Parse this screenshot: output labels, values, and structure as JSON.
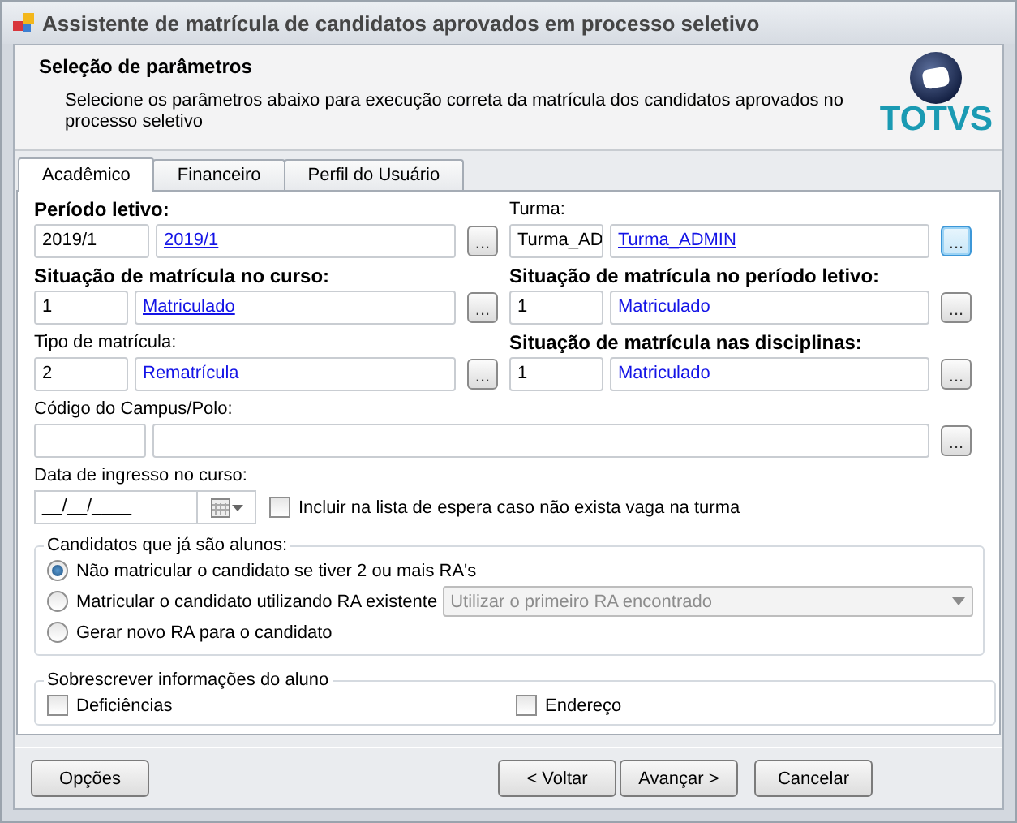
{
  "window": {
    "title": "Assistente de matrícula de candidatos aprovados em processo seletivo"
  },
  "header": {
    "title": "Seleção de parâmetros",
    "description": "Selecione os parâmetros abaixo para execução correta da matrícula dos candidatos aprovados no processo seletivo",
    "logo": "TOTVS"
  },
  "tabs": [
    {
      "label": "Acadêmico",
      "selected": true
    },
    {
      "label": "Financeiro",
      "selected": false
    },
    {
      "label": "Perfil do Usuário",
      "selected": false
    }
  ],
  "fields": [
    {
      "label": "Período letivo:",
      "required": true,
      "code": "2019/1",
      "description": "2019/1",
      "underlined": true,
      "button": "...",
      "focused": false
    },
    {
      "label": "Turma:",
      "required": false,
      "code": "Turma_AD",
      "description": "Turma_ADMIN",
      "underlined": true,
      "button": "...",
      "focused": true
    },
    {
      "label": "Situação de matrícula no curso:",
      "required": true,
      "code": "1",
      "description": "Matriculado",
      "underlined": true,
      "button": "...",
      "focused": false
    },
    {
      "label": "Situação de matrícula no período letivo:",
      "required": true,
      "code": "1",
      "description": "Matriculado",
      "underlined": false,
      "button": "...",
      "focused": false
    },
    {
      "label": "Tipo de matrícula:",
      "required": false,
      "code": "2",
      "description": "Rematrícula",
      "underlined": false,
      "button": "...",
      "focused": false
    },
    {
      "label": "Situação de matrícula nas disciplinas:",
      "required": true,
      "code": "1",
      "description": "Matriculado",
      "underlined": false,
      "button": "...",
      "focused": false
    },
    {
      "label": "Código do Campus/Polo:",
      "required": false,
      "button": "...",
      "focused": false
    }
  ],
  "date_field": {
    "label": "Data de ingresso no curso:",
    "value": "__/__/____"
  },
  "waitlist": {
    "label": "Incluir na lista de espera caso não exista vaga na turma",
    "checked": false
  },
  "students_group": {
    "title": "Candidatos que já são alunos:",
    "options": [
      {
        "label": "Não matricular o candidato se tiver 2 ou mais RA's",
        "selected": true
      },
      {
        "label": "Matricular o candidato utilizando RA existente",
        "selected": false,
        "dropdown": {
          "value": "Utilizar o primeiro RA encontrado",
          "disabled": true
        }
      },
      {
        "label": "Gerar novo RA para o candidato",
        "selected": false
      }
    ]
  },
  "overwrite_group": {
    "title": "Sobrescrever informações do aluno",
    "options": [
      {
        "label": "Deficiências",
        "checked": false
      },
      {
        "label": "Endereço",
        "checked": false
      }
    ]
  },
  "buttons": [
    {
      "label": "Opções",
      "kind": "left"
    },
    {
      "label": "< Voltar",
      "kind": "nav"
    },
    {
      "label": "Avançar >",
      "kind": "nav"
    },
    {
      "label": "Cancelar",
      "kind": "cancel"
    }
  ]
}
